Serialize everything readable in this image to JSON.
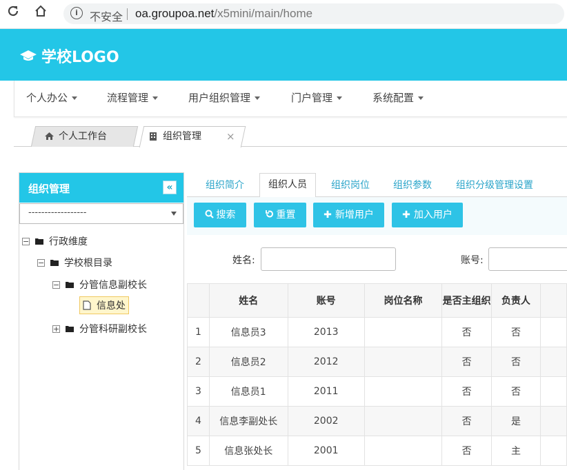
{
  "browser": {
    "security_text": "不安全",
    "host": "oa.groupoa.net",
    "path": "/x5mini/main/home"
  },
  "header": {
    "logo_text": "学校LOGO",
    "brand_color": "#23c6e7"
  },
  "nav": {
    "items": [
      "个人办公",
      "流程管理",
      "用户组织管理",
      "门户管理",
      "系统配置"
    ]
  },
  "page_tabs": [
    {
      "label": "个人工作台",
      "icon": "home-icon"
    },
    {
      "label": "组织管理",
      "icon": "building-icon"
    }
  ],
  "left_panel": {
    "title": "组织管理",
    "collapse_glyph": "«",
    "select_value": "------------------",
    "tree": [
      {
        "label": "行政维度",
        "toggle": "⊟"
      },
      {
        "label": "学校根目录",
        "toggle": "⊟"
      },
      {
        "label": "分管信息副校长",
        "toggle": "⊟"
      },
      {
        "label": "信息处"
      },
      {
        "label": "分管科研副校长",
        "toggle": "⊞"
      }
    ]
  },
  "right_panel": {
    "tabs": [
      "组织简介",
      "组织人员",
      "组织岗位",
      "组织参数",
      "组织分级管理设置"
    ],
    "active_tab": "组织人员",
    "buttons": [
      {
        "icon": "search-icon",
        "label": "搜索"
      },
      {
        "icon": "reset-icon",
        "label": "重置"
      },
      {
        "icon": "plus-icon",
        "label": "新增用户"
      },
      {
        "icon": "plus-icon",
        "label": "加入用户"
      }
    ],
    "search": {
      "name_label": "姓名:",
      "account_label": "账号:"
    },
    "table": {
      "columns": [
        "姓名",
        "账号",
        "岗位名称",
        "是否主组织",
        "负责人"
      ],
      "rows": [
        {
          "no": "1",
          "name": "信息员3",
          "account": "2013",
          "post": "",
          "main_org": "否",
          "leader": "否"
        },
        {
          "no": "2",
          "name": "信息员2",
          "account": "2012",
          "post": "",
          "main_org": "否",
          "leader": "否"
        },
        {
          "no": "3",
          "name": "信息员1",
          "account": "2011",
          "post": "",
          "main_org": "否",
          "leader": "否"
        },
        {
          "no": "4",
          "name": "信息李副处长",
          "account": "2002",
          "post": "",
          "main_org": "否",
          "leader": "是"
        },
        {
          "no": "5",
          "name": "信息张处长",
          "account": "2001",
          "post": "",
          "main_org": "否",
          "leader": "主"
        }
      ]
    }
  }
}
